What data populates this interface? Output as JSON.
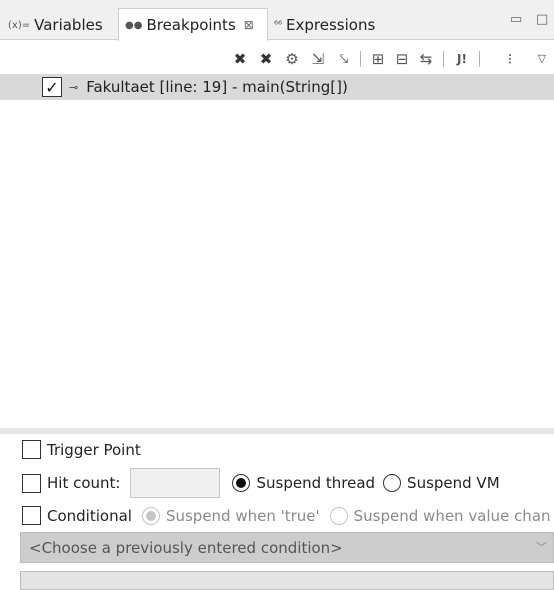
{
  "tabs": [
    {
      "label": "Variables",
      "icon": "(x)=",
      "icon_name": "variables-icon",
      "active": false
    },
    {
      "label": "Breakpoints",
      "icon": "●●",
      "icon_name": "breakpoints-icon",
      "active": true,
      "close": "⊠"
    },
    {
      "label": "Expressions",
      "icon": "⁶⁶",
      "icon_name": "expressions-icon",
      "active": false
    }
  ],
  "window_controls": {
    "minimize": "▭",
    "maximize": "□"
  },
  "toolbar": {
    "remove": "✖",
    "remove_all": "✖",
    "show_supported": "⚙",
    "go_to_file": "⇲",
    "skip_all": "⤥",
    "expand_all": "⊞",
    "collapse_all": "⊟",
    "link_with_debug_view": "⇆",
    "java_exception": "J!",
    "group_by": "⁝",
    "view_menu": "▽"
  },
  "breakpoints": [
    {
      "label": "Fakultaet [line: 19] - main(String[])",
      "checked": true,
      "check": "✓",
      "marker": "⊸"
    }
  ],
  "detail": {
    "trigger_point_label": "Trigger Point",
    "hit_count_label": "Hit count:",
    "suspend_thread_label": "Suspend thread",
    "suspend_vm_label": "Suspend VM",
    "conditional_label": "Conditional",
    "suspend_when_true_label": "Suspend when 'true'",
    "suspend_when_changed_label": "Suspend when value chan",
    "condition_placeholder": "<Choose a previously entered condition>",
    "combo_arrow": "﹀"
  }
}
